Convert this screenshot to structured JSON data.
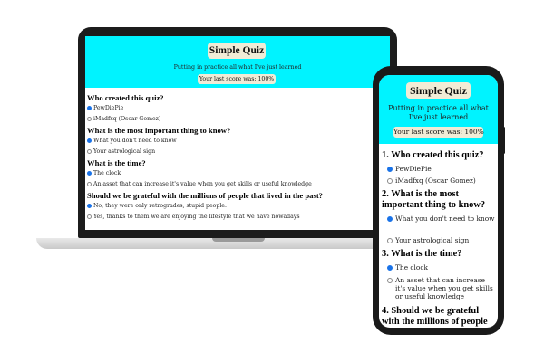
{
  "quiz": {
    "title": "Simple Quiz",
    "subtitle": "Putting in practice all what I've just learned",
    "last_score": "Your last score was: 100%"
  },
  "laptop": {
    "questions": [
      {
        "text": "Who created this quiz?",
        "options": [
          "PewDiePie",
          "iMadfxq (Oscar Gomez)"
        ],
        "selected": 0
      },
      {
        "text": "What is the most important thing to know?",
        "options": [
          "What you don't need to know",
          "Your astrological sign"
        ],
        "selected": 0
      },
      {
        "text": "What is the time?",
        "options": [
          "The clock",
          "An asset that can increase it's value when you get skills or useful knowledge"
        ],
        "selected": 0
      },
      {
        "text": "Should we be grateful with the millions of people that lived in the past?",
        "options": [
          "No, they were only retrogrades, stupid people.",
          "Yes, thanks to them we are enjoying the lifestyle that we have nowadays"
        ],
        "selected": 0
      }
    ]
  },
  "phone": {
    "questions": [
      {
        "text": "1. Who created this quiz?",
        "options": [
          "PewDiePie",
          "iMadfxq (Oscar Gomez)"
        ],
        "selected": 0
      },
      {
        "text": "2. What is the most important thing to know?",
        "options": [
          "What you don't need to know",
          "Your astrological sign"
        ],
        "selected": 0
      },
      {
        "text": "3. What is the time?",
        "options": [
          "The clock",
          "An asset that can increase it's value when you get skills or useful knowledge"
        ],
        "selected": 0
      },
      {
        "text": "4. Should we be grateful with the millions of people",
        "options": [],
        "selected": -1
      }
    ]
  },
  "colors": {
    "header_bg": "#00f3ff",
    "badge_bg": "#f1ecd6",
    "device_frame": "#1a1a1a",
    "radio_selected": "#1a73e8"
  }
}
